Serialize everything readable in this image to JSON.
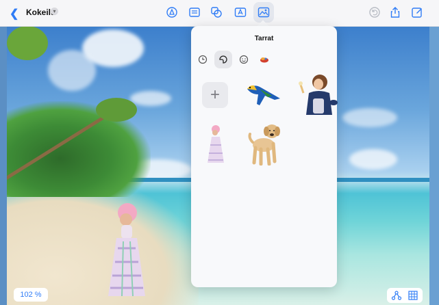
{
  "toolbar": {
    "back_icon": "chevron-left-icon",
    "document_title": "Kokeilu",
    "title_menu_icon": "chevron-down-icon",
    "tools": [
      "pen-tip-icon",
      "text-box-icon",
      "shapes-icon",
      "text-field-icon",
      "photo-sticker-icon"
    ],
    "selected_tool": "photo-sticker-icon",
    "right_tools": [
      "undo-icon",
      "share-icon",
      "edit-icon"
    ],
    "accent_color": "#2f7cf6"
  },
  "popover": {
    "title": "Tarrat",
    "categories": [
      "recent-clock-icon",
      "sticker-peel-icon",
      "emoji-smiley-icon",
      "apps-sticker-icon"
    ],
    "active_category": "sticker-peel-icon",
    "add_button_icon": "plus-icon",
    "stickers": [
      "parrot-sticker",
      "child-with-ice-cream-sticker",
      "girl-in-dress-sticker",
      "puppy-sticker"
    ]
  },
  "bottom": {
    "zoom_level": "102 %",
    "right_tools": [
      "tree-diagram-icon",
      "grid-view-icon"
    ]
  }
}
